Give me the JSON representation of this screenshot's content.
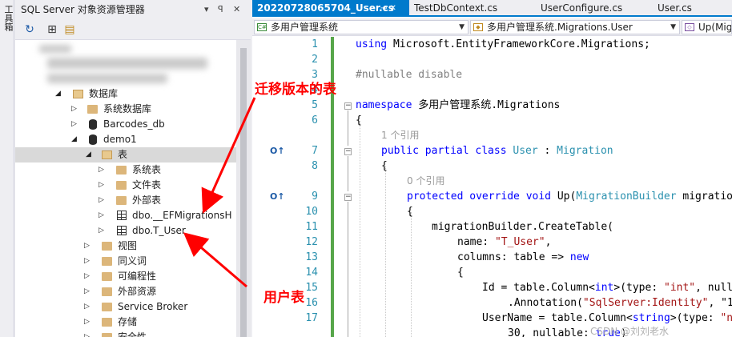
{
  "toolbox": {
    "label": "工具箱"
  },
  "object_explorer": {
    "title": "SQL Server 对象资源管理器",
    "pin": "▾",
    "pin2": "ꟼ",
    "close": "✕",
    "tree": [
      {
        "label": "数据库"
      },
      {
        "label": "系统数据库"
      },
      {
        "label": "Barcodes_db"
      },
      {
        "label": "demo1"
      },
      {
        "label": "表"
      },
      {
        "label": "系统表"
      },
      {
        "label": "文件表"
      },
      {
        "label": "外部表"
      },
      {
        "label": "dbo.__EFMigrationsH"
      },
      {
        "label": "dbo.T_User"
      },
      {
        "label": "视图"
      },
      {
        "label": "同义词"
      },
      {
        "label": "可编程性"
      },
      {
        "label": "外部资源"
      },
      {
        "label": "Service Broker"
      },
      {
        "label": "存储"
      },
      {
        "label": "安全性"
      }
    ]
  },
  "editor": {
    "tabs": [
      {
        "label": "20220728065704_User.cs",
        "active": true
      },
      {
        "label": "TestDbContext.cs"
      },
      {
        "label": "UserConfigure.cs"
      },
      {
        "label": "User.cs"
      }
    ],
    "tab_controls": "⊸ ✕",
    "nav": {
      "project": "多用户管理系统",
      "type": "多用户管理系统.Migrations.User",
      "member": "Up(Mig"
    },
    "line_numbers": [
      "1",
      "2",
      "3",
      "4",
      "5",
      "6",
      "7",
      "8",
      "9",
      "10",
      "11",
      "12",
      "13",
      "14",
      "15",
      "16",
      "17"
    ],
    "codelens": {
      "refs1": "1 个引用",
      "refs0": "0 个引用"
    },
    "code": {
      "l1_kw": "using",
      "l1_rest": " Microsoft.EntityFrameworkCore.Migrations;",
      "l3": "#nullable disable",
      "l5_kw": "namespace",
      "l5_rest": " 多用户管理系统.Migrations",
      "l6": "{",
      "l7_kw": "public partial class",
      "l7_type": "User",
      "l7_colon": " : ",
      "l7_base": "Migration",
      "l8": "{",
      "l9_kw": "protected override void",
      "l9_name": " Up(",
      "l9_type": "MigrationBuilder",
      "l9_rest": " migratio",
      "l10": "{",
      "l11": "migrationBuilder.CreateTable(",
      "l12_a": "name: ",
      "l12_str": "\"T_User\"",
      "l12_b": ",",
      "l13_a": "columns: table => ",
      "l13_kw": "new",
      "l14": "{",
      "l15_a": "Id = table.Column<",
      "l15_kw": "int",
      "l15_b": ">(type: ",
      "l15_str": "\"int\"",
      "l15_c": ", null",
      "l16_a": ".Annotation(",
      "l16_str": "\"SqlServer:Identity\"",
      "l16_b": ", \"1",
      "l17_a": "UserName = table.Column<",
      "l17_kw": "string",
      "l17_b": ">(type: ",
      "l17_str": "\"n",
      "l18_a": "30, nullable: ",
      "l18_kw": "true",
      "l18_b": ")"
    }
  },
  "annotations": {
    "migration_table": "迁移版本的表",
    "user_table": "用户表"
  },
  "watermark": "CSDN @刘刘老水",
  "colors": {
    "accent": "#007acc",
    "annotation": "#ff0000",
    "keyword": "#0000ff",
    "type": "#2b91af",
    "string": "#a31515"
  }
}
